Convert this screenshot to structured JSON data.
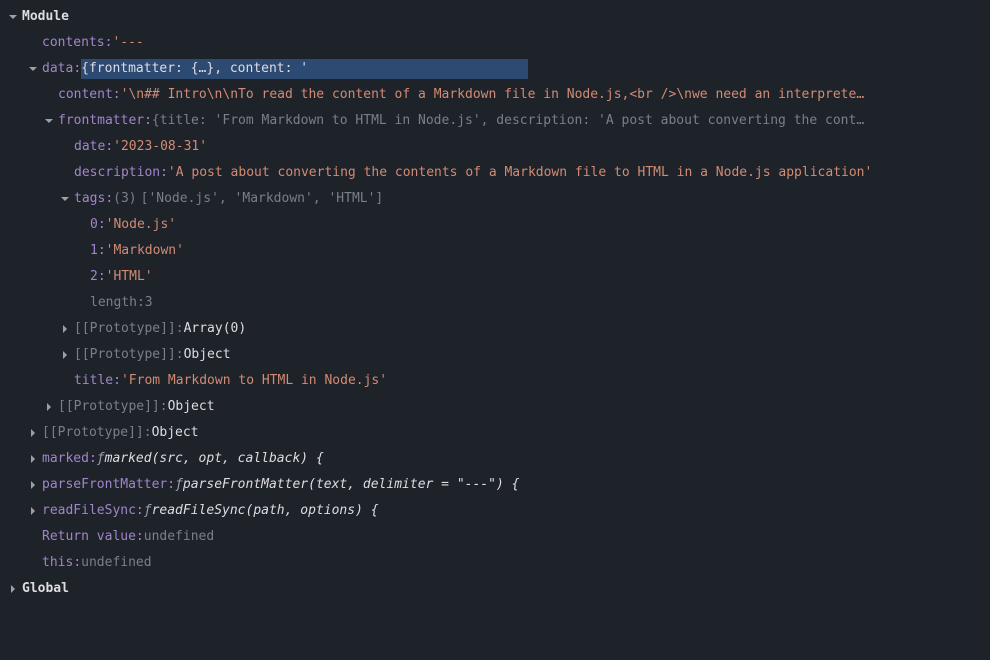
{
  "module": {
    "label": "Module",
    "contents": {
      "key": "contents",
      "value": "'---"
    },
    "data": {
      "key": "data",
      "summary": "{frontmatter: {…}, content: '",
      "content": {
        "key": "content",
        "value": "'\\n## Intro\\n\\nTo read the content of a Markdown file in Node.js,<br />\\nwe need an interprete…"
      },
      "frontmatter": {
        "key": "frontmatter",
        "summary": "{title: 'From Markdown to HTML in Node.js', description: 'A post about converting the cont…",
        "date": {
          "key": "date",
          "value": "'2023-08-31'"
        },
        "description": {
          "key": "description",
          "value": "'A post about converting the contents of a Markdown file to HTML in a Node.js application'"
        },
        "tags": {
          "key": "tags",
          "count": "(3)",
          "preview": "['Node.js', 'Markdown', 'HTML']",
          "items": [
            {
              "idx": "0",
              "value": "'Node.js'"
            },
            {
              "idx": "1",
              "value": "'Markdown'"
            },
            {
              "idx": "2",
              "value": "'HTML'"
            }
          ],
          "length": {
            "key": "length",
            "value": "3"
          },
          "proto": {
            "key": "[[Prototype]]",
            "value": "Array(0)"
          }
        },
        "proto": {
          "key": "[[Prototype]]",
          "value": "Object"
        },
        "title": {
          "key": "title",
          "value": "'From Markdown to HTML in Node.js'"
        }
      },
      "proto": {
        "key": "[[Prototype]]",
        "value": "Object"
      }
    },
    "proto": {
      "key": "[[Prototype]]",
      "value": "Object"
    },
    "marked": {
      "key": "marked",
      "sig": "marked(src, opt, callback) {"
    },
    "parseFrontMatter": {
      "key": "parseFrontMatter",
      "sig": "parseFrontMatter(text, delimiter = \"---\") {"
    },
    "readFileSync": {
      "key": "readFileSync",
      "sig": "readFileSync(path, options) {"
    },
    "returnValue": {
      "key": "Return value",
      "value": "undefined"
    },
    "this": {
      "key": "this",
      "value": "undefined"
    }
  },
  "global": {
    "label": "Global"
  }
}
